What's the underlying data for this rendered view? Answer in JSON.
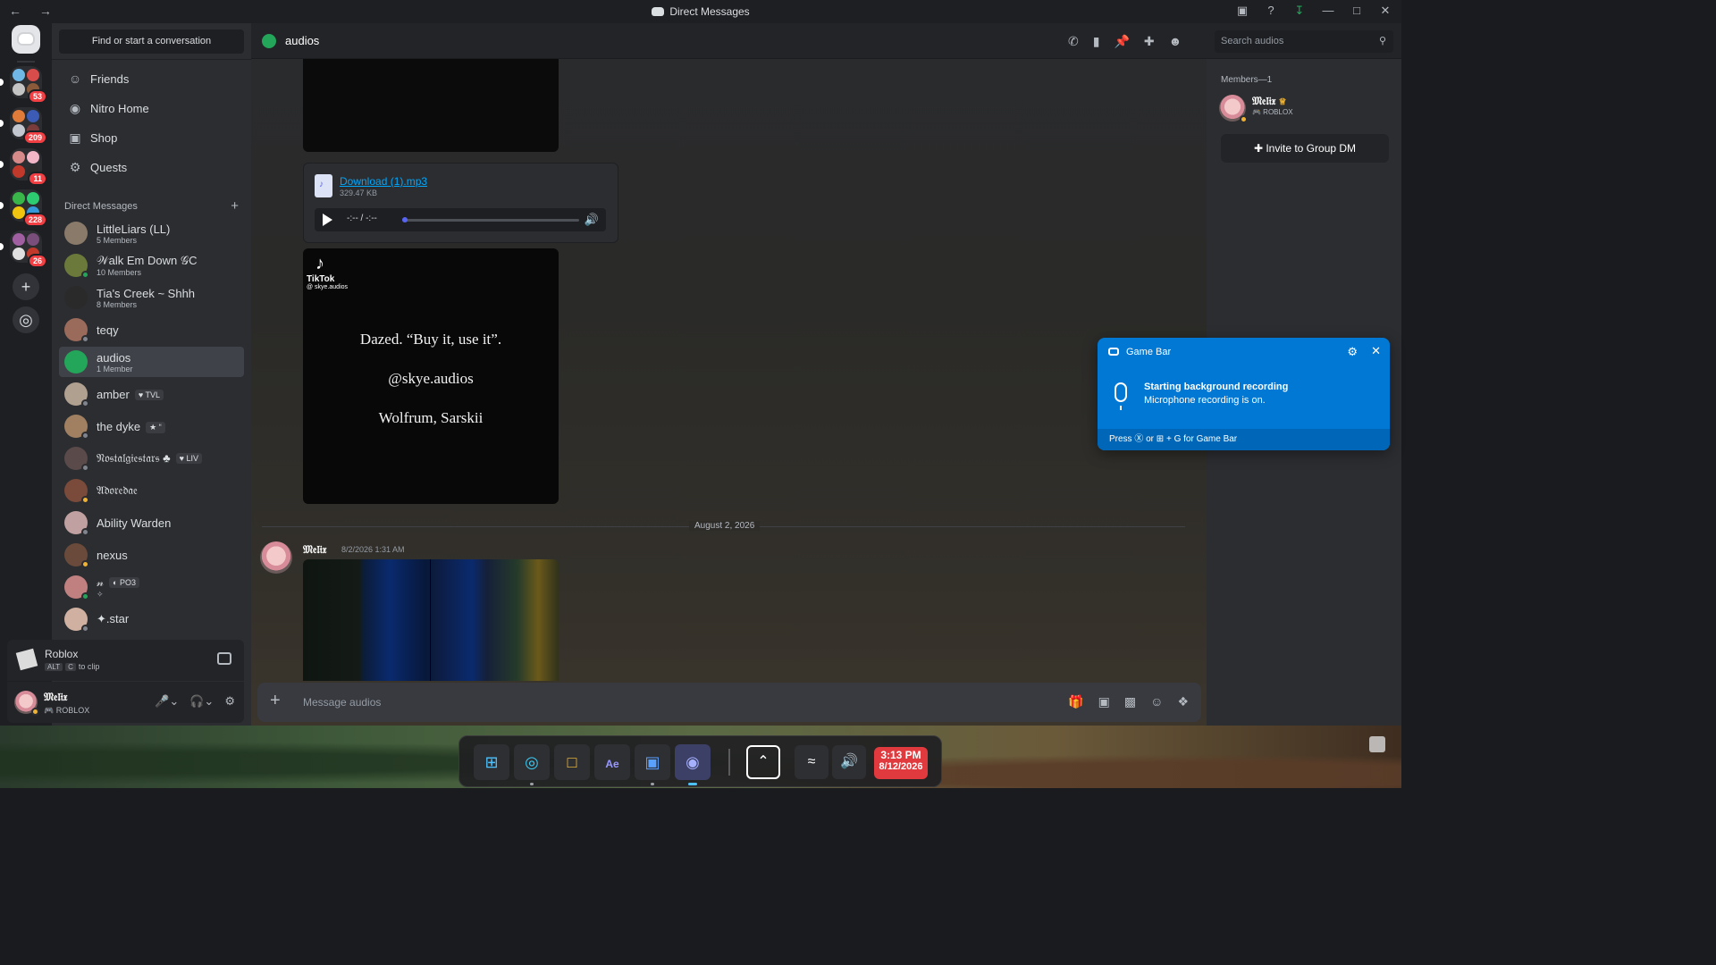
{
  "window": {
    "title": "Direct Messages",
    "nav": "← →",
    "controls": [
      "inbox-icon",
      "help-icon",
      "download-icon",
      "minimize-icon",
      "maximize-icon",
      "close-icon"
    ]
  },
  "rail": {
    "folders": [
      {
        "badge": "53",
        "colors": [
          "#6fb7e6",
          "#d94c4c",
          "#c4c4c4",
          "#8a5a3a"
        ]
      },
      {
        "badge": "209",
        "colors": [
          "#e07b39",
          "#3b5bb5",
          "#c2c7d0",
          "#7a3b3b"
        ]
      },
      {
        "badge": "11",
        "colors": [
          "#d68a8a",
          "#f2b6c6",
          "#c0392b",
          "#2b2b2b"
        ]
      },
      {
        "badge": "228",
        "colors": [
          "#39b54a",
          "#2ecc71",
          "#f1c40f",
          "#3498db"
        ]
      },
      {
        "badge": "26",
        "colors": [
          "#a05fa0",
          "#7a4e7a",
          "#e0e0e0",
          "#c0392b"
        ]
      }
    ],
    "add_server": "+",
    "discover": "◎"
  },
  "sidebar": {
    "search_label": "Find or start a conversation",
    "nav": [
      {
        "label": "Friends",
        "icon": "friends-icon",
        "glyph": "☺"
      },
      {
        "label": "Nitro Home",
        "icon": "nitro-icon",
        "glyph": "◉"
      },
      {
        "label": "Shop",
        "icon": "shop-icon",
        "glyph": "▣"
      },
      {
        "label": "Quests",
        "icon": "quests-icon",
        "glyph": "⚙"
      }
    ],
    "dm_header": "Direct Messages",
    "dms": [
      {
        "name": "LittleLiars (LL)",
        "sub": "5 Members",
        "color": "#8a7a6a",
        "status": ""
      },
      {
        "name": "𝒲alk Em Down 𝒢C",
        "sub": "10 Members",
        "color": "#6b7a3a",
        "status": "#23a55a"
      },
      {
        "name": "Tia's Creek ~ Shhh",
        "sub": "8 Members",
        "color": "#2a2a2a",
        "status": ""
      },
      {
        "name": "teqy",
        "sub": "",
        "color": "#9a6a5a",
        "status": "#80848e"
      },
      {
        "name": "audios",
        "sub": "1 Member",
        "color": "#23a55a",
        "status": "",
        "active": true
      },
      {
        "name": "amber",
        "sub": "",
        "tag": "♥ TVL",
        "color": "#b0a090",
        "status": "#80848e"
      },
      {
        "name": "the dyke",
        "sub": "",
        "tag": "★ “",
        "color": "#a08060",
        "status": "#80848e"
      },
      {
        "name": "𝔑𝔬𝔰𝔱𝔞𝔩𝔤𝔦𝔢𝔰𝔱𝔞𝔯𝔰 ♣",
        "sub": "",
        "tag": "♥ LIV",
        "color": "#5a4a4a",
        "status": "#80848e"
      },
      {
        "name": "𝔄𝔡𝔬𝔯𝔢𝔡𝔞𝔢",
        "sub": "",
        "color": "#7a4a3a",
        "status": "#f0b232"
      },
      {
        "name": "Ability Warden",
        "sub": "",
        "color": "#c0a0a0",
        "status": "#80848e"
      },
      {
        "name": "nexus",
        "sub": "",
        "color": "#6a4a3a",
        "status": "#f0b232"
      },
      {
        "name": "𝓃",
        "sub": "✧",
        "tag": "◐ PO3",
        "color": "#c08080",
        "status": "#23a55a"
      },
      {
        "name": "✦.star",
        "sub": "",
        "color": "#d0b0a0",
        "status": "#80848e"
      }
    ]
  },
  "activity": {
    "name": "Roblox",
    "key1": "ALT",
    "key2": "C",
    "hint": "to clip"
  },
  "user": {
    "name": "𝔐𝔢𝔩𝔦𝔵",
    "status": "🎮 ROBLOX"
  },
  "chat": {
    "channel": "audios",
    "search_placeholder": "Search audios",
    "header_icons": [
      "call-icon",
      "video-icon",
      "pin-icon",
      "add-friend-icon",
      "members-icon"
    ],
    "attachment": {
      "filename": "Download (1).mp3",
      "size": "329.47 KB",
      "time": "-:-- / -:--"
    },
    "tiktok": {
      "brand": "TikTok",
      "handle": "@ skye.audios",
      "lines": [
        "Dazed. “Buy it, use it”.",
        "@skye.audios",
        "Wolfrum, Sarskii"
      ]
    },
    "divider_date": "August 2, 2026",
    "message": {
      "author": "𝔐𝔢𝔩𝔦𝔵",
      "timestamp": "8/2/2026 1:31 AM"
    },
    "composer_placeholder": "Message audios"
  },
  "members": {
    "header": "Members—1",
    "list": [
      {
        "name": "𝔐𝔢𝔩𝔦𝔵",
        "sub": "🎮 ROBLOX"
      }
    ],
    "invite_label": "Invite to Group DM"
  },
  "toast": {
    "app": "Game Bar",
    "heading": "Starting background recording",
    "body": "Microphone recording is on.",
    "footer": "Press Ⓧ or ⊞ + G for Game Bar"
  },
  "taskbar": {
    "time": "3:13 PM",
    "date": "8/12/2026"
  }
}
